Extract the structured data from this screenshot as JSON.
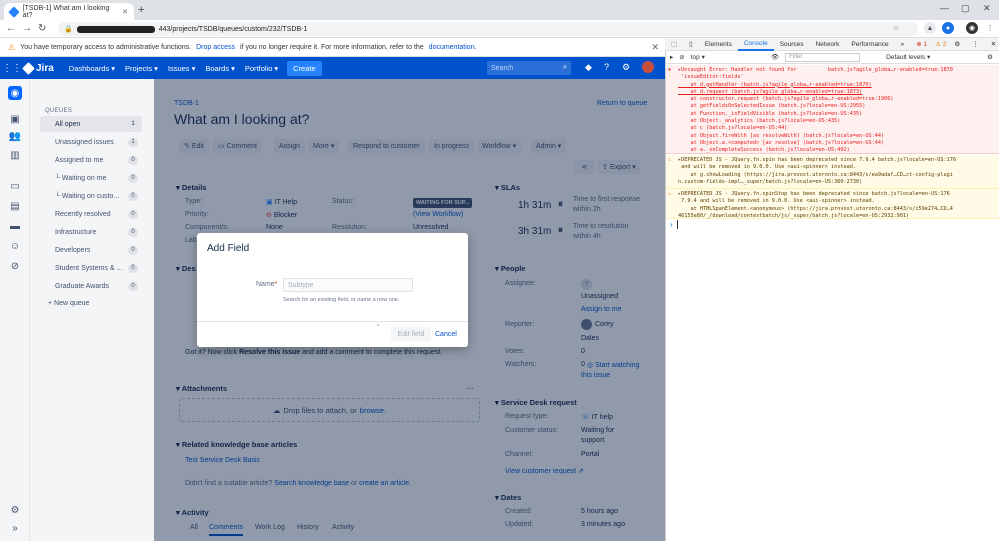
{
  "browser": {
    "tab_title": "[TSDB-1] What am I looking at?",
    "url_suffix": "443/projects/TSDB/queues/custom/232/TSDB-1"
  },
  "banner": {
    "text_pre": "You have temporary access to administrative functions.",
    "link1": "Drop access",
    "text_mid": "if you no longer require it. For more information, refer to the",
    "link2": "documentation."
  },
  "nav": {
    "logo": "Jira",
    "items": [
      "Dashboards",
      "Projects",
      "Issues",
      "Boards",
      "Portfolio"
    ],
    "create": "Create",
    "search_placeholder": "Search"
  },
  "queues": {
    "heading": "QUEUES",
    "items": [
      {
        "label": "All open",
        "count": "1"
      },
      {
        "label": "Unassigned issues",
        "count": "1"
      },
      {
        "label": "Assigned to me",
        "count": "0"
      },
      {
        "label": "└ Waiting on me",
        "count": "0"
      },
      {
        "label": "└ Waiting on custo...",
        "count": "0"
      },
      {
        "label": "Recently resolved",
        "count": "0"
      },
      {
        "label": "Infrastructure",
        "count": "0"
      },
      {
        "label": "Developers",
        "count": "0"
      },
      {
        "label": "Student Systems & ...",
        "count": "0"
      },
      {
        "label": "Graduate Awards",
        "count": "0"
      }
    ],
    "new_queue": "+ New queue"
  },
  "issue": {
    "key": "TSDB-1",
    "title": "What am I looking at?",
    "return_link": "Return to queue",
    "toolbar": [
      "Edit",
      "Comment",
      "Assign",
      "More",
      "Respond to customer",
      "In progress",
      "Workflow",
      "Admin"
    ],
    "export": "Export",
    "details_heading": "Details",
    "type_label": "Type:",
    "type_value": "IT Help",
    "status_label": "Status:",
    "status_value": "WAITING FOR SUP...",
    "view_workflow": "(View Workflow)",
    "priority_label": "Priority:",
    "priority_value": "Blocker",
    "resolution_label": "Resolution:",
    "resolution_value": "Unresolved",
    "component_label": "Component/s:",
    "component_value": "None",
    "labels_label": "Lab",
    "desc_label": "Des",
    "gotit_pre": "Got it? Now click",
    "gotit_bold": "Resolve this issue",
    "gotit_post": "and add a comment to complete this request.",
    "attachments_heading": "Attachments",
    "drop_text": "Drop files to attach, or",
    "browse": "browse.",
    "kb_heading": "Related knowledge base articles",
    "kb_link": "Test Service Desk Basic",
    "kb_text_pre": "Didn't find a suitable article?",
    "kb_search": "Search knowledge base",
    "kb_or": "or",
    "kb_create": "create an article.",
    "activity_heading": "Activity",
    "activity_tabs": [
      "All",
      "Comments",
      "Work Log",
      "History",
      "Activity"
    ]
  },
  "slas": {
    "heading": "SLAs",
    "items": [
      {
        "time": "1h 31m",
        "desc": "Time to first response",
        "within": "within 2h"
      },
      {
        "time": "3h 31m",
        "desc": "Time to resolution",
        "within": "within 4h"
      }
    ]
  },
  "people": {
    "heading": "People",
    "assignee_label": "Assignee:",
    "assignee_value": "Unassigned",
    "assign_to_me": "Assign to me",
    "reporter_label": "Reporter:",
    "reporter_value_1": "Corey",
    "reporter_value_2": "Dales",
    "votes_label": "Votes:",
    "votes_value": "0",
    "watchers_label": "Watchers:",
    "watchers_value": "0",
    "start_watching": "Start watching",
    "this_issue": "this issue"
  },
  "service_desk": {
    "heading": "Service Desk request",
    "req_type_label": "Request type:",
    "req_type_value": "IT help",
    "cust_status_label": "Customer status:",
    "cust_status_value_1": "Waiting for",
    "cust_status_value_2": "support",
    "channel_label": "Channel:",
    "channel_value": "Portal",
    "view_request": "View customer request"
  },
  "dates": {
    "heading": "Dates",
    "created_label": "Created:",
    "created_value": "5 hours ago",
    "updated_label": "Updated:",
    "updated_value": "3 minutes ago"
  },
  "modal": {
    "title": "Add Field",
    "name_label": "Name",
    "placeholder": "Subtype",
    "hint": "Search for an existing field, or name a new one.",
    "edit_field": "Edit field",
    "cancel": "Cancel"
  },
  "devtools": {
    "tabs": [
      "Elements",
      "Console",
      "Sources",
      "Network",
      "Performance"
    ],
    "active_tab": "Console",
    "error_count": "1",
    "warn_count": "2",
    "context": "top",
    "filter_placeholder": "Filter",
    "levels": "Default levels",
    "error_lines": [
      "▸Uncaught Error: Handler not found for          batch.js?agile_globa…r-enabled=true:1870",
      " 'issueEditor:fields'",
      "    at d.getHandler (batch.js?agile_globa…r-enabled=true:1870)",
      "    at d.request (batch.js?agile_globa…r-enabled=true:1873)",
      "    at constructor.request (batch.js?agile_globa…r-enabled=true:1906)",
      "    at getFieldsOnSelectedIssue (batch.js?locale=en-US:2955)",
      "    at Function._isFieldVisible (batch.js?locale=en-US:435)",
      "    at Object._analytics (batch.js?locale=en-US:435)",
      "    at c (batch.js?locale=en-US:44)",
      "    at Object.fireWith [as resolveWith] (batch.js?locale=en-US:44)",
      "    at Object.a.<computed> [as resolve] (batch.js?locale=en-US:44)",
      "    at a._onCompleteSuccess (batch.js?locale=en-US:402)"
    ],
    "warn1_lines": [
      "▸DEPRECATED JS - JQuery.fn.spin has been deprecated since 7.9.4 batch.js?locale=en-US:176",
      " and will be removed in 9.0.0. Use <aui-spinner> instead.",
      "    at g.showLoading (https://jira.provost.utoronto.ca:8443/s/ea9adaf…CD…ct-config-plugi",
      "n.custom-fields-impl…_super/batch.js?locale=en-US:360:2730)"
    ],
    "warn2_lines": [
      "▸DEPRECATED JS - JQuery.fn.spinStop has been deprecated since batch.js?locale=en-US:176",
      " 7.9.4 and will be removed in 9.0.0. Use <aui-spinner> instead.",
      "    at HTMLSpanElement.<anonymous> (https://jira.provost.utoronto.ca:8443/s/c59e274…CD…4",
      "46155e80/_/download/contextbatch/js/_super/batch.js?locale=en-US:2932:901)"
    ]
  }
}
